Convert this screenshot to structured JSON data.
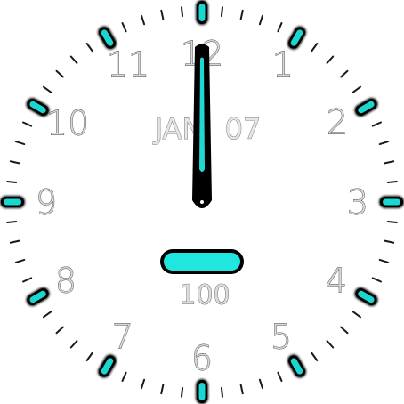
{
  "face": {
    "background": "#ffffff",
    "accent": "#22e8e0",
    "marker_fill": "#19d6d0",
    "marker_outline": "#000000",
    "tick_color": "#1a1a1a"
  },
  "numerals": [
    "12",
    "1",
    "2",
    "3",
    "4",
    "5",
    "6",
    "7",
    "8",
    "9",
    "10",
    "11"
  ],
  "date": {
    "month": "JAN",
    "day": "07"
  },
  "status": {
    "battery_percent": "100"
  },
  "time": {
    "hours": 12,
    "minutes": 0
  },
  "icons": {
    "battery": "battery-pill-icon",
    "hands": "clock-hands-icon"
  }
}
